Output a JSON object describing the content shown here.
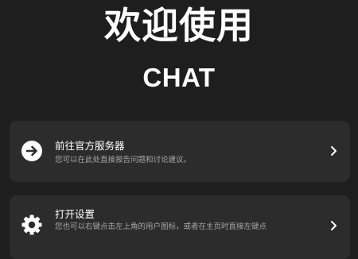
{
  "header": {
    "title": "欢迎使用",
    "app_name": "CHAT"
  },
  "cards": [
    {
      "icon": "arrow-right-circle-icon",
      "title": "前往官方服务器",
      "description": "您可以在此处直接报告问题和讨论建议。"
    },
    {
      "icon": "gear-icon",
      "title": "打开设置",
      "description": "您也可以右键点击左上角的用户图标，或者在主页时直接左键点"
    }
  ],
  "colors": {
    "background": "#1e1e1e",
    "card": "#2c2c2c",
    "text": "#ffffff",
    "muted_text": "#a8a8a8"
  }
}
